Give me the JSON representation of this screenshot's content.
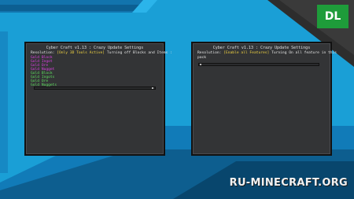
{
  "left_panel": {
    "title": "Cyber Craft v1.13 : Crazy Update Settings",
    "resolution_prefix": "Resolution:",
    "resolution_value": "[Only 3D Tools Active]",
    "resolution_suffix": "Turning off Blocks and Items :",
    "items_magenta": [
      "Gold Block",
      "Gold Ingot",
      "Gold Ore",
      "Gold Nugget"
    ],
    "items_green": [
      "Gold Block",
      "Gold Ingots",
      "Gold Ore",
      "Gold Nuggets"
    ]
  },
  "right_panel": {
    "title": "Cyber Craft v1.13 : Crazy Update Settings",
    "resolution_prefix": "Resolution:",
    "resolution_value": "[Enable all Features]",
    "resolution_suffix": "Turning On all feature in this",
    "resolution_line2": "pack"
  },
  "badge": {
    "label": "DL"
  },
  "watermark": {
    "text": "RU-MINECRAFT.ORG"
  },
  "colors": {
    "background": "#1a9fd6",
    "dark_band": "#0f6fa3",
    "panel": "#333436",
    "highlight": "#f5d742",
    "magenta": "#e040e6",
    "green": "#5fe05f",
    "badge": "#1e9c3a"
  }
}
